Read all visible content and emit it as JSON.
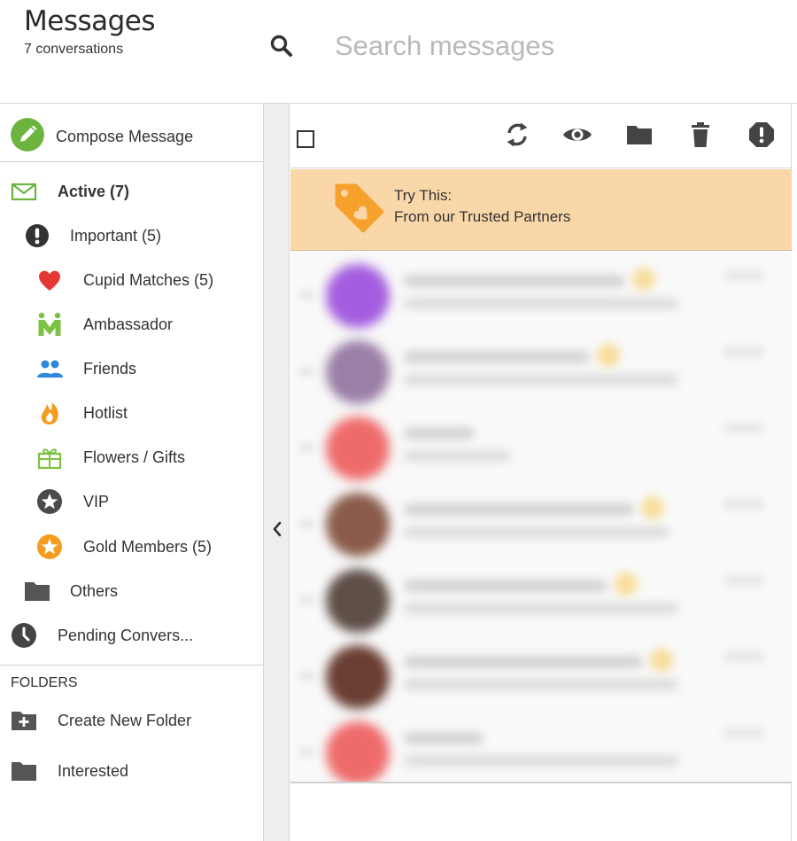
{
  "header": {
    "title": "Messages",
    "subtitle": "7 conversations",
    "search_placeholder": "Search messages"
  },
  "sidebar": {
    "compose_label": "Compose Message",
    "items": [
      {
        "label": "Active (7)",
        "icon": "envelope-icon"
      },
      {
        "label": "Important (5)",
        "icon": "exclamation-icon"
      },
      {
        "label": "Cupid Matches (5)",
        "icon": "heart-icon"
      },
      {
        "label": "Ambassador",
        "icon": "ambassador-m-icon"
      },
      {
        "label": "Friends",
        "icon": "people-icon"
      },
      {
        "label": "Hotlist",
        "icon": "flame-icon"
      },
      {
        "label": "Flowers / Gifts",
        "icon": "gift-icon"
      },
      {
        "label": "VIP",
        "icon": "vip-star-icon"
      },
      {
        "label": "Gold Members (5)",
        "icon": "gold-star-icon"
      },
      {
        "label": "Others",
        "icon": "folder-icon"
      },
      {
        "label": "Pending Convers...",
        "icon": "clock-icon"
      }
    ],
    "folders_header": "FOLDERS",
    "folders": [
      {
        "label": "Create New Folder",
        "icon": "folder-plus-icon"
      },
      {
        "label": "Interested",
        "icon": "folder-icon"
      }
    ]
  },
  "toolbar": {
    "tools": [
      "refresh-icon",
      "eye-icon",
      "folder-icon",
      "trash-icon",
      "report-icon"
    ]
  },
  "promo": {
    "line1": "Try This:",
    "line2": "From our Trusted Partners"
  },
  "conversations": {
    "count": 7,
    "avatar_colors": [
      "#a45de0",
      "#9b7fa6",
      "#ef6b6b",
      "#8a5b4a",
      "#5e4f47",
      "#6a3e33",
      "#ef6b6b"
    ]
  },
  "colors": {
    "accent_green": "#6db33f",
    "promo_bg": "#f9d7a8",
    "promo_tag": "#f5a12b",
    "icon_dark": "#333333"
  }
}
